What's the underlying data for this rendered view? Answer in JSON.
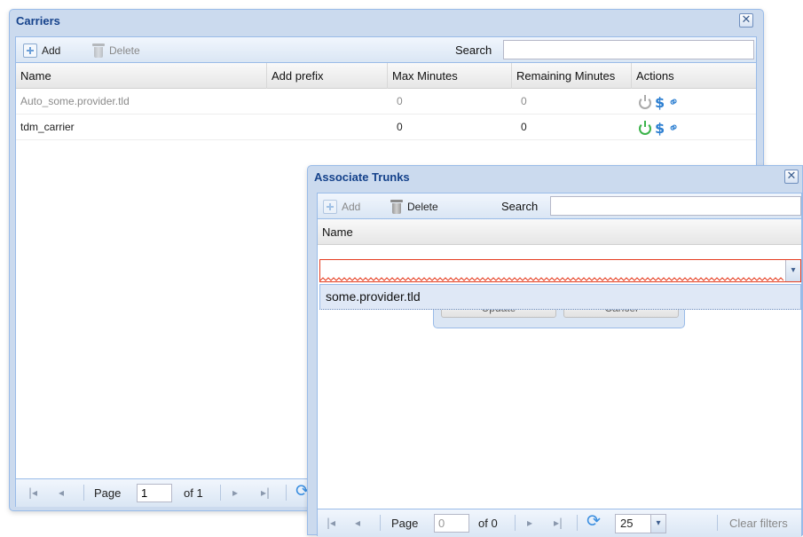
{
  "carriers": {
    "title": "Carriers",
    "close_glyph": "✕",
    "toolbar": {
      "add_label": "Add",
      "delete_label": "Delete",
      "search_label": "Search",
      "search_value": ""
    },
    "columns": [
      "Name",
      "Add prefix",
      "Max Minutes",
      "Remaining Minutes",
      "Actions"
    ],
    "rows": [
      {
        "name": "Auto_some.provider.tld",
        "add_prefix": "",
        "max_minutes": "0",
        "remaining_minutes": "0",
        "enabled": false
      },
      {
        "name": "tdm_carrier",
        "add_prefix": "",
        "max_minutes": "0",
        "remaining_minutes": "0",
        "enabled": true
      }
    ],
    "pager": {
      "page_label": "Page",
      "page_value": "1",
      "of_label": "of 1"
    }
  },
  "trunks": {
    "title": "Associate Trunks",
    "close_glyph": "✕",
    "toolbar": {
      "add_label": "Add",
      "delete_label": "Delete",
      "search_label": "Search",
      "search_value": ""
    },
    "columns": [
      "Name"
    ],
    "editor": {
      "combo_value": "",
      "dropdown_options": [
        "some.provider.tld"
      ],
      "update_label": "Update",
      "cancel_label": "Cancel"
    },
    "pager": {
      "page_label": "Page",
      "page_value": "0",
      "of_label": "of 0",
      "page_size": "25",
      "clear_filters_label": "Clear filters"
    }
  },
  "icons": {
    "power": "power-icon",
    "dollar": "dollar-icon",
    "link": "link-icon",
    "first": "|◂",
    "prev": "◂",
    "next": "▸",
    "last": "▸|",
    "refresh": "refresh-icon",
    "dropdown": "▾"
  },
  "colors": {
    "accent": "#15428b",
    "enabled_green": "#3bb34a",
    "action_blue": "#2d7fd1",
    "invalid_red": "#e53c1f"
  }
}
